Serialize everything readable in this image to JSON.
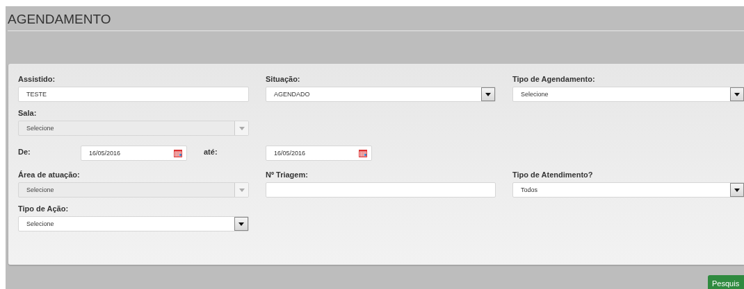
{
  "page": {
    "title": "AGENDAMENTO"
  },
  "rows": [
    {
      "fields": [
        {
          "kind": "text",
          "label": "Assistido:",
          "value": "TESTE",
          "disabled": false
        },
        {
          "kind": "select",
          "label": "Situação:",
          "value": "AGENDADO",
          "disabled": false
        },
        {
          "kind": "select",
          "label": "Tipo de Agendamento:",
          "value": "Selecione",
          "disabled": false
        }
      ]
    },
    {
      "fields": [
        {
          "kind": "select",
          "label": "Sala:",
          "value": "Selecione",
          "disabled": true
        }
      ]
    },
    {
      "fields": [
        {
          "kind": "date",
          "label": "De:",
          "value": "16/05/2016",
          "disabled": false
        },
        {
          "kind": "date",
          "label": "até:",
          "value": "16/05/2016",
          "disabled": false
        }
      ]
    },
    {
      "fields": [
        {
          "kind": "select",
          "label": "Área de atuação:",
          "value": "Selecione",
          "disabled": true
        },
        {
          "kind": "text",
          "label": "Nº Triagem:",
          "disabled": false
        },
        {
          "kind": "select",
          "label": "Tipo de Atendimento?",
          "value": "Todos",
          "disabled": false
        }
      ]
    },
    {
      "fields": [
        {
          "kind": "select",
          "label": "Tipo de Ação:",
          "value": "Selecione",
          "disabled": false
        }
      ]
    }
  ],
  "search_button": {
    "label": "Pesquis"
  }
}
